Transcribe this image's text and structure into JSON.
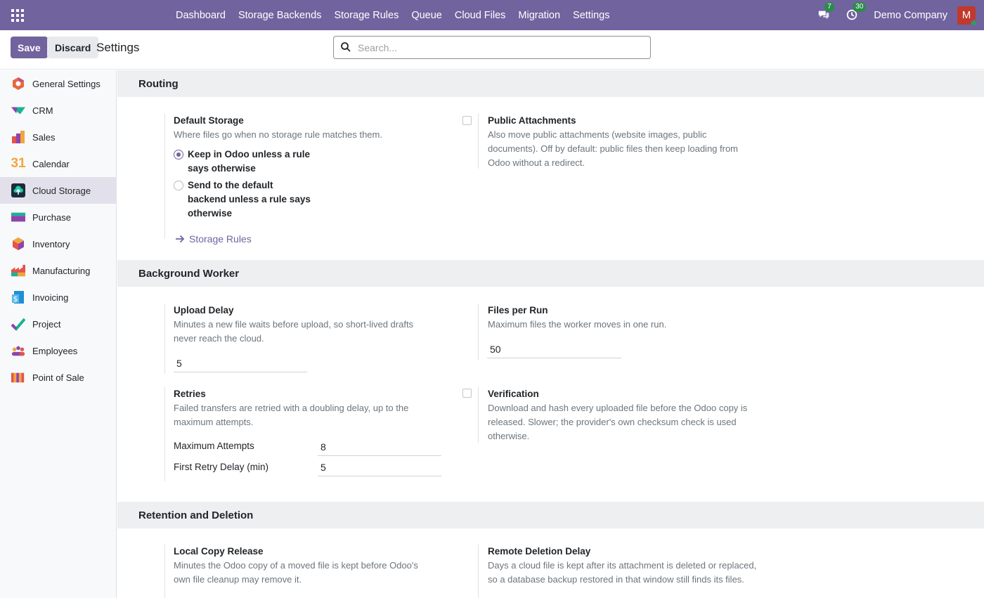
{
  "topbar": {
    "menu": [
      "Dashboard",
      "Storage Backends",
      "Storage Rules",
      "Queue",
      "Cloud Files",
      "Migration",
      "Settings"
    ],
    "messages_count": "7",
    "activities_count": "30",
    "company": "Demo Company",
    "avatar_initial": "M",
    "colors": {
      "bar": "#71639e",
      "badge": "#2a8c4a",
      "avatar": "#c0392b"
    }
  },
  "control": {
    "save": "Save",
    "discard": "Discard",
    "title": "Settings",
    "search_placeholder": "Search..."
  },
  "sidebar": {
    "items": [
      {
        "label": "General Settings",
        "icon": "odoo-logo-icon"
      },
      {
        "label": "CRM",
        "icon": "crm-icon"
      },
      {
        "label": "Sales",
        "icon": "sales-icon"
      },
      {
        "label": "Calendar",
        "icon": "calendar-icon",
        "glyph": "31"
      },
      {
        "label": "Cloud Storage",
        "icon": "cloud-storage-icon",
        "active": true
      },
      {
        "label": "Purchase",
        "icon": "purchase-icon"
      },
      {
        "label": "Inventory",
        "icon": "inventory-icon"
      },
      {
        "label": "Manufacturing",
        "icon": "manufacturing-icon"
      },
      {
        "label": "Invoicing",
        "icon": "invoicing-icon"
      },
      {
        "label": "Project",
        "icon": "project-icon"
      },
      {
        "label": "Employees",
        "icon": "employees-icon"
      },
      {
        "label": "Point of Sale",
        "icon": "pos-icon"
      }
    ]
  },
  "routing": {
    "header": "Routing",
    "default_storage": {
      "title": "Default Storage",
      "desc": "Where files go when no storage rule matches them.",
      "options": [
        "Keep in Odoo unless a rule says otherwise",
        "Send to the default backend unless a rule says otherwise"
      ],
      "selected": 0,
      "link": "Storage Rules"
    },
    "public_attachments": {
      "title": "Public Attachments",
      "desc": "Also move public attachments (website images, public documents). Off by default: public files then keep loading from Odoo without a redirect.",
      "checked": false
    }
  },
  "worker": {
    "header": "Background Worker",
    "upload_delay": {
      "title": "Upload Delay",
      "desc": "Minutes a new file waits before upload, so short-lived drafts never reach the cloud.",
      "value": "5"
    },
    "files_per_run": {
      "title": "Files per Run",
      "desc": "Maximum files the worker moves in one run.",
      "value": "50"
    },
    "retries": {
      "title": "Retries",
      "desc": "Failed transfers are retried with a doubling delay, up to the maximum attempts.",
      "max_label": "Maximum Attempts",
      "max_value": "8",
      "first_label": "First Retry Delay (min)",
      "first_value": "5"
    },
    "verification": {
      "title": "Verification",
      "desc": "Download and hash every uploaded file before the Odoo copy is released. Slower; the provider's own checksum check is used otherwise.",
      "checked": false
    }
  },
  "retention": {
    "header": "Retention and Deletion",
    "local_copy": {
      "title": "Local Copy Release",
      "desc": "Minutes the Odoo copy of a moved file is kept before Odoo's own file cleanup may remove it."
    },
    "remote_deletion": {
      "title": "Remote Deletion Delay",
      "desc": "Days a cloud file is kept after its attachment is deleted or replaced, so a database backup restored in that window still finds its files."
    }
  }
}
